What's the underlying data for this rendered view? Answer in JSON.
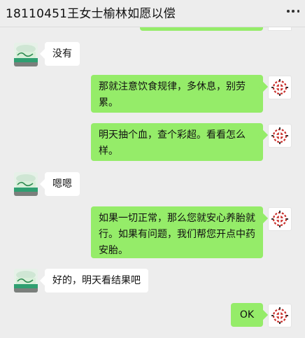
{
  "header": {
    "title": "18110451王女士榆林如愿以偿",
    "more_icon": "more-dots-icon"
  },
  "messages": [
    {
      "side": "left",
      "text": "没有"
    },
    {
      "side": "right",
      "text": "那就注意饮食规律，多休息，别劳累。"
    },
    {
      "side": "right",
      "text": "明天抽个血，查个彩超。看看怎么样。"
    },
    {
      "side": "left",
      "text": "嗯嗯"
    },
    {
      "side": "right",
      "text": "如果一切正常，那么您就安心养胎就行。如果有问题，我们帮您开点中药安胎。"
    },
    {
      "side": "left",
      "text": "好的，明天看结果吧"
    },
    {
      "side": "right",
      "text": "OK"
    }
  ],
  "colors": {
    "background": "#ededed",
    "self_bubble": "#95ec69",
    "other_bubble": "#ffffff"
  }
}
